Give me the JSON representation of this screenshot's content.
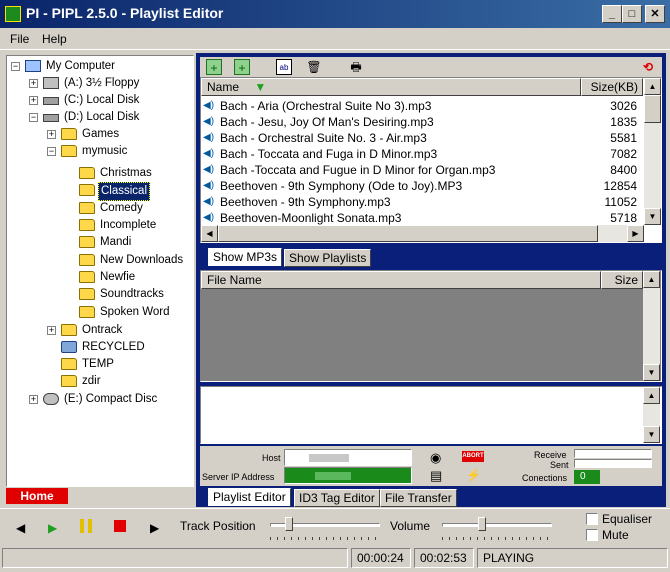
{
  "window": {
    "title": "PI - PIPL 2.5.0 - Playlist Editor",
    "buttons": {
      "minimize": "_",
      "maximize": "□",
      "close": "✕"
    }
  },
  "menubar": {
    "items": [
      {
        "label": "File",
        "accel": "F"
      },
      {
        "label": "Help",
        "accel": "H"
      }
    ]
  },
  "tree": {
    "root": "My Computer",
    "floppy": "(A:) 3½ Floppy",
    "c_drive": "(C:) Local Disk",
    "d_drive": "(D:) Local Disk",
    "games": "Games",
    "mymusic": "mymusic",
    "children": [
      "Christmas",
      "Classical",
      "Comedy",
      "Incomplete",
      "Mandi",
      "New Downloads",
      "Newfie",
      "Soundtracks",
      "Spoken Word"
    ],
    "selected": "Classical",
    "ontrack": "Ontrack",
    "recycled": "RECYCLED",
    "temp": "TEMP",
    "zdir": "zdir",
    "e_drive": "(E:) Compact Disc"
  },
  "home_button": "Home",
  "mp3_list": {
    "columns": {
      "name": "Name",
      "size": "Size(KB)"
    },
    "rows": [
      {
        "name": "Bach - Aria (Orchestral Suite No 3).mp3",
        "size": "3026"
      },
      {
        "name": "Bach - Jesu, Joy Of Man's Desiring.mp3",
        "size": "1835"
      },
      {
        "name": "Bach - Orchestral Suite No. 3 - Air.mp3",
        "size": "5581"
      },
      {
        "name": "Bach - Toccata and Fuga in D Minor.mp3",
        "size": "7082"
      },
      {
        "name": "Bach -Toccata and Fugue in D Minor for Organ.mp3",
        "size": "8400"
      },
      {
        "name": "Beethoven - 9th Symphony (Ode to Joy).MP3",
        "size": "12854"
      },
      {
        "name": "Beethoven - 9th Symphony.mp3",
        "size": "11052"
      },
      {
        "name": "Beethoven-Moonlight Sonata.mp3",
        "size": "5718"
      }
    ]
  },
  "list_tabs": [
    "Show MP3s",
    "Show Playlists"
  ],
  "playlist": {
    "columns": {
      "file": "File Name",
      "size": "Size"
    }
  },
  "network": {
    "host_label": "Host",
    "ip_label": "Server IP Address",
    "receive_label": "Receive",
    "sent_label": "Sent",
    "connections_label": "Conections",
    "connections_value": "0",
    "abort_label": "ABORT"
  },
  "bottom_tabs": [
    "Playlist Editor",
    "ID3 Tag Editor",
    "File Transfer"
  ],
  "player": {
    "track_position_label": "Track Position",
    "volume_label": "Volume",
    "track_position": 0.17,
    "volume": 0.36,
    "equaliser_label": "Equaliser",
    "mute_label": "Mute",
    "equaliser_checked": false,
    "mute_checked": false
  },
  "status": {
    "elapsed": "00:00:24",
    "total": "00:02:53",
    "state": "PLAYING"
  },
  "colors": {
    "title_start": "#0a246a",
    "title_end": "#3a6ea5",
    "panel_blue": "#0a1f7a",
    "home_red": "#e00000",
    "ip_field_green": "#1a8a1a"
  }
}
